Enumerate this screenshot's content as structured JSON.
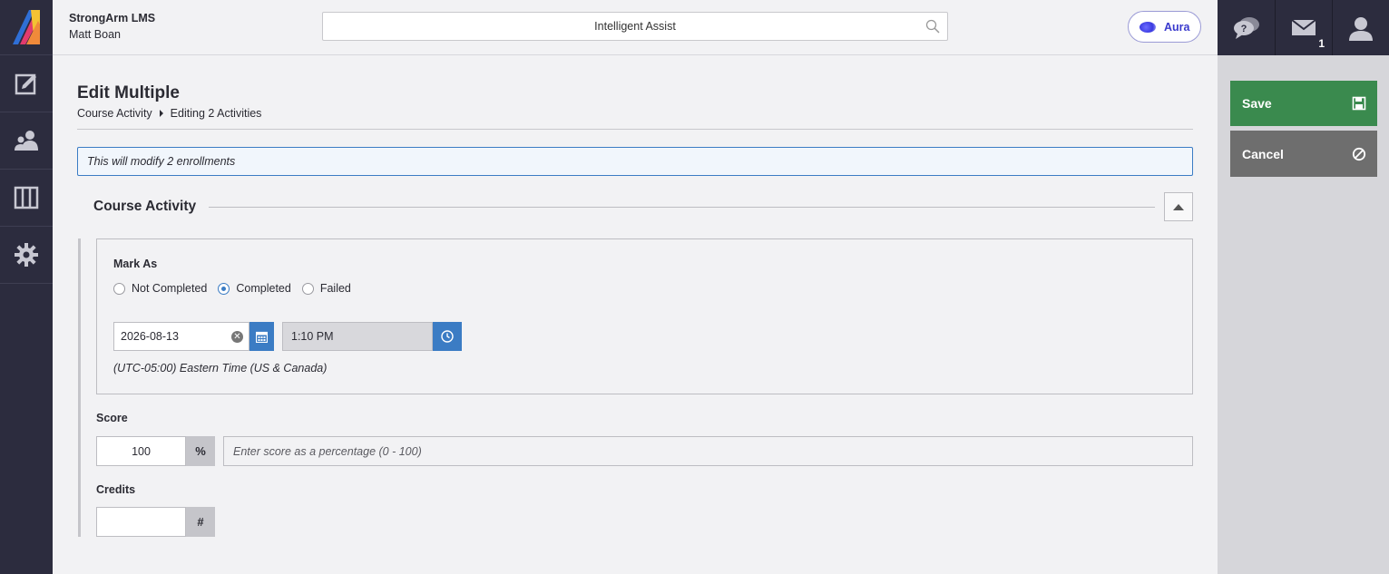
{
  "app": {
    "org_name": "StrongArm LMS",
    "user_name": "Matt Boan"
  },
  "search": {
    "placeholder": "Intelligent Assist"
  },
  "aura": {
    "label": "Aura"
  },
  "topbar_icons": {
    "messages_count": "1"
  },
  "nav": {
    "items": [
      "edit-icon",
      "users-icon",
      "columns-icon",
      "gear-icon"
    ]
  },
  "page": {
    "title": "Edit Multiple",
    "breadcrumb": [
      "Course Activity",
      "Editing 2 Activities"
    ],
    "notice": "This will modify 2 enrollments"
  },
  "section": {
    "title": "Course Activity",
    "mark_as": {
      "label": "Mark As",
      "options": [
        "Not Completed",
        "Completed",
        "Failed"
      ],
      "selected": "Completed"
    },
    "date": "2026-08-13",
    "time": "1:10 PM",
    "timezone": "(UTC-05:00) Eastern Time (US & Canada)",
    "score": {
      "label": "Score",
      "value": "100",
      "suffix": "%",
      "hint": "Enter score as a percentage (0 - 100)"
    },
    "credits": {
      "label": "Credits",
      "value": "",
      "suffix": "#"
    }
  },
  "actions": {
    "save": "Save",
    "cancel": "Cancel"
  },
  "colors": {
    "nav_bg": "#2c2c3e",
    "accent_blue": "#3b7cc4",
    "save_green": "#3a8a4e",
    "cancel_gray": "#6e6e6e",
    "aura_purple": "#3a3acd"
  }
}
